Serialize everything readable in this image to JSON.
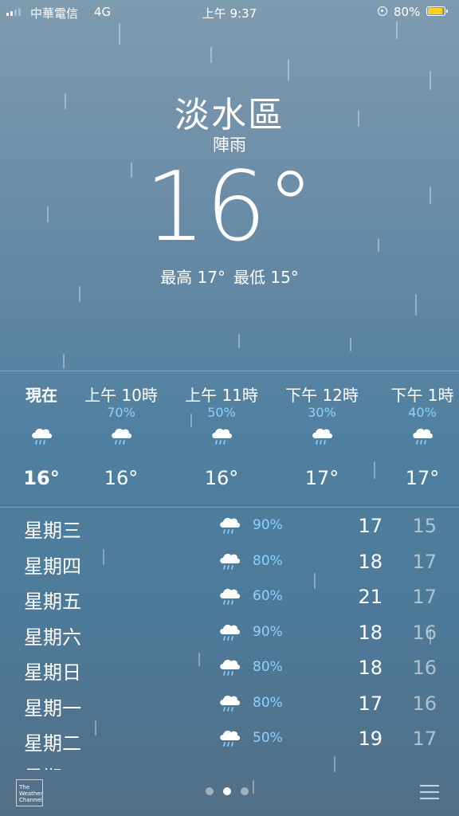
{
  "status_bar": {
    "carrier": "中華電信",
    "network": "4G",
    "time": "上午 9:37",
    "battery": "80%",
    "battery_level": 0.8,
    "battery_color": "#ffd21e"
  },
  "location": {
    "city": "淡水區",
    "condition": "陣雨",
    "temperature": "16°",
    "high": "最高 17°",
    "low": "最低 15°"
  },
  "hourly": [
    {
      "label": "現在",
      "pop": "",
      "icon": "rain-cloud-icon",
      "temp": "16°"
    },
    {
      "label": "上午 10時",
      "pop": "70%",
      "icon": "rain-cloud-icon",
      "temp": "16°"
    },
    {
      "label": "上午 11時",
      "pop": "50%",
      "icon": "rain-cloud-icon",
      "temp": "16°"
    },
    {
      "label": "下午 12時",
      "pop": "30%",
      "icon": "rain-cloud-icon",
      "temp": "17°"
    },
    {
      "label": "下午 1時",
      "pop": "40%",
      "icon": "rain-cloud-icon",
      "temp": "17°"
    }
  ],
  "daily": [
    {
      "day": "星期三",
      "pop": "90%",
      "high": "17",
      "low": "15",
      "icon": "rain-cloud-icon"
    },
    {
      "day": "星期四",
      "pop": "80%",
      "high": "18",
      "low": "17",
      "icon": "rain-cloud-icon"
    },
    {
      "day": "星期五",
      "pop": "60%",
      "high": "21",
      "low": "17",
      "icon": "rain-cloud-icon"
    },
    {
      "day": "星期六",
      "pop": "90%",
      "high": "18",
      "low": "16",
      "icon": "rain-cloud-icon"
    },
    {
      "day": "星期日",
      "pop": "80%",
      "high": "18",
      "low": "16",
      "icon": "rain-cloud-icon"
    },
    {
      "day": "星期一",
      "pop": "80%",
      "high": "17",
      "low": "16",
      "icon": "rain-cloud-icon"
    },
    {
      "day": "星期二",
      "pop": "50%",
      "high": "19",
      "low": "17",
      "icon": "rain-cloud-icon"
    }
  ],
  "partial_row": "星期三",
  "footer": {
    "logo_text": "The Weather Channel",
    "pages": 3,
    "active_page": 2
  },
  "colors": {
    "pop_text": "#8fd0ff"
  }
}
